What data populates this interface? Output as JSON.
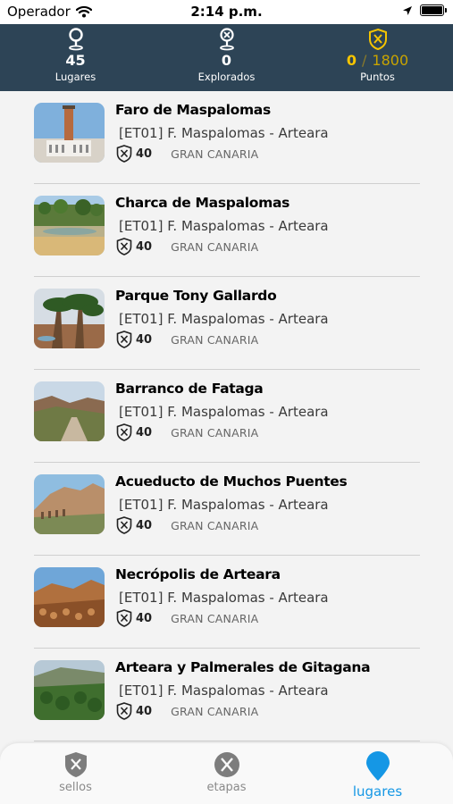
{
  "status_bar": {
    "carrier": "Operador",
    "time": "2:14 p.m."
  },
  "stats": {
    "places": {
      "value": "45",
      "label": "Lugares",
      "icon": "map-pin-icon"
    },
    "explored": {
      "value": "0",
      "label": "Explorados",
      "icon": "explored-pin-icon"
    },
    "points": {
      "current": "0",
      "separator": "/",
      "total": "1800",
      "label": "Puntos",
      "icon": "shield-badge-icon"
    }
  },
  "colors": {
    "header_bg": "#2d4456",
    "points_accent": "#f5c400",
    "active_tab": "#1597e5"
  },
  "places": [
    {
      "title": "Faro de Maspalomas",
      "stage": "[ET01] F. Maspalomas - Arteara",
      "points": "40",
      "region": "GRAN CANARIA",
      "image": "lighthouse"
    },
    {
      "title": "Charca de Maspalomas",
      "stage": "[ET01] F. Maspalomas - Arteara",
      "points": "40",
      "region": "GRAN CANARIA",
      "image": "pond"
    },
    {
      "title": "Parque Tony Gallardo",
      "stage": "[ET01] F. Maspalomas - Arteara",
      "points": "40",
      "region": "GRAN CANARIA",
      "image": "palms"
    },
    {
      "title": "Barranco de Fataga",
      "stage": "[ET01] F. Maspalomas - Arteara",
      "points": "40",
      "region": "GRAN CANARIA",
      "image": "ravine"
    },
    {
      "title": "Acueducto de Muchos Puentes",
      "stage": "[ET01] F. Maspalomas - Arteara",
      "points": "40",
      "region": "GRAN CANARIA",
      "image": "aqueduct"
    },
    {
      "title": "Necrópolis de Arteara",
      "stage": "[ET01] F. Maspalomas - Arteara",
      "points": "40",
      "region": "GRAN CANARIA",
      "image": "necropolis"
    },
    {
      "title": "Arteara y Palmerales de Gitagana",
      "stage": "[ET01] F. Maspalomas - Arteara",
      "points": "40",
      "region": "GRAN CANARIA",
      "image": "valley"
    }
  ],
  "tabs": [
    {
      "label": "sellos",
      "icon": "shield-stamp-icon",
      "active": false
    },
    {
      "label": "etapas",
      "icon": "hiking-poles-icon",
      "active": false
    },
    {
      "label": "lugares",
      "icon": "location-pin-icon",
      "active": true
    }
  ]
}
